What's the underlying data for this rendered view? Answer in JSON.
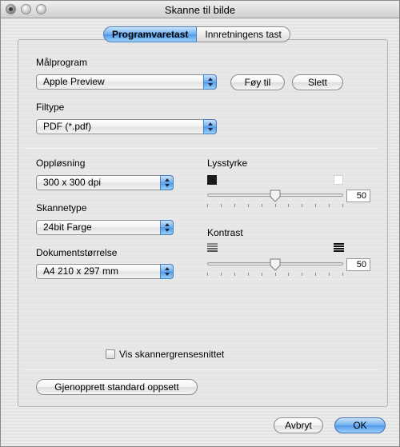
{
  "window": {
    "title": "Skanne til bilde"
  },
  "tabs": [
    {
      "label": "Programvaretast",
      "active": true
    },
    {
      "label": "Innretningens tast",
      "active": false
    }
  ],
  "target_app": {
    "label": "Målprogram",
    "selected": "Apple Preview",
    "add_label": "Føy til",
    "delete_label": "Slett"
  },
  "file_type": {
    "label": "Filtype",
    "selected": "PDF (*.pdf)"
  },
  "resolution": {
    "label": "Oppløsning",
    "selected": "300 x 300 dpi"
  },
  "scan_type": {
    "label": "Skannetype",
    "selected": "24bit Farge"
  },
  "document_size": {
    "label": "Dokumentstørrelse",
    "selected": "A4  210 x 297 mm"
  },
  "brightness": {
    "label": "Lysstyrke",
    "value": "50",
    "level": 0.5
  },
  "contrast": {
    "label": "Kontrast",
    "value": "50",
    "level": 0.5
  },
  "show_scanner_ui": {
    "label": "Vis skannergrensesnittet",
    "checked": false
  },
  "restore_defaults_label": "Gjenopprett standard oppsett",
  "cancel_label": "Avbryt",
  "ok_label": "OK",
  "colors": {
    "accent": "#6eaef0",
    "window_bg": "#e8e8e8"
  }
}
